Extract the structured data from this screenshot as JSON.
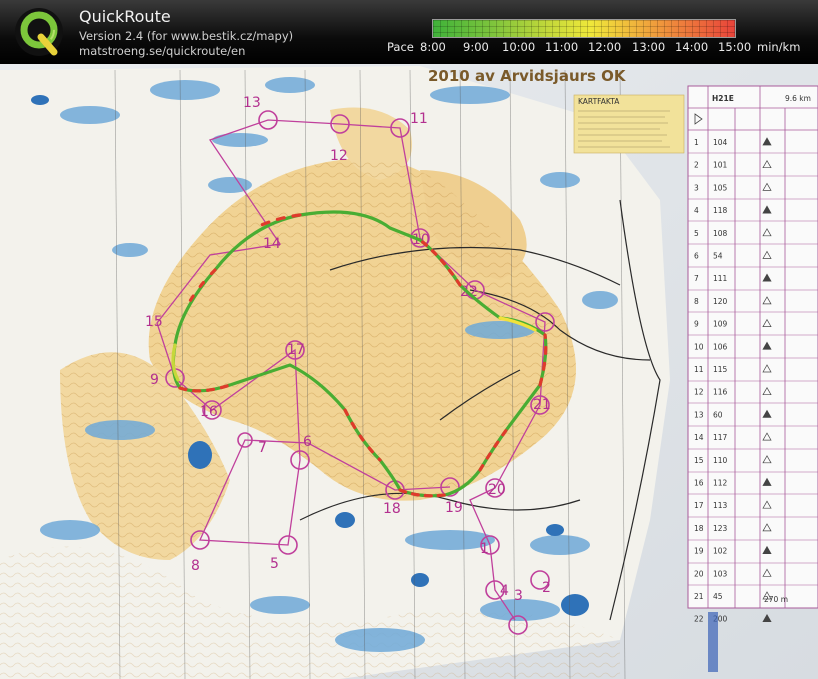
{
  "header": {
    "app_name": "QuickRoute",
    "version_line": "Version 2.4  (for www.bestik.cz/mapy)",
    "url": "matstroeng.se/quickroute/en"
  },
  "pace_scale": {
    "label": "Pace",
    "ticks": [
      "8:00",
      "9:00",
      "10:00",
      "11:00",
      "12:00",
      "13:00",
      "14:00",
      "15:00"
    ],
    "unit": "min/km",
    "colors": [
      "#3fb23a",
      "#7fc53c",
      "#c3d83a",
      "#efe83a",
      "#f0b83c",
      "#ee7f3c",
      "#e8433a"
    ]
  },
  "map": {
    "header_text": "2010 av Arvidsjaurs OK",
    "kartfakta_title": "KARTFAKTA",
    "control_labels": [
      "1",
      "2",
      "3",
      "4",
      "5",
      "6",
      "7",
      "8",
      "9",
      "10",
      "11",
      "12",
      "13",
      "14",
      "15",
      "16",
      "17",
      "18",
      "19",
      "20",
      "21",
      "22"
    ],
    "description_sheet": {
      "class": "H21E",
      "distance": "9.6 km",
      "footer_distance": "270 m",
      "rows": [
        {
          "num": "1",
          "code": "104"
        },
        {
          "num": "2",
          "code": "101"
        },
        {
          "num": "3",
          "code": "105"
        },
        {
          "num": "4",
          "code": "118"
        },
        {
          "num": "5",
          "code": "108"
        },
        {
          "num": "6",
          "code": "54"
        },
        {
          "num": "7",
          "code": "111"
        },
        {
          "num": "8",
          "code": "120"
        },
        {
          "num": "9",
          "code": "109"
        },
        {
          "num": "10",
          "code": "106"
        },
        {
          "num": "11",
          "code": "115"
        },
        {
          "num": "12",
          "code": "116"
        },
        {
          "num": "13",
          "code": "60"
        },
        {
          "num": "14",
          "code": "117"
        },
        {
          "num": "15",
          "code": "110"
        },
        {
          "num": "16",
          "code": "112"
        },
        {
          "num": "17",
          "code": "113"
        },
        {
          "num": "18",
          "code": "123"
        },
        {
          "num": "19",
          "code": "102"
        },
        {
          "num": "20",
          "code": "103"
        },
        {
          "num": "21",
          "code": "45"
        },
        {
          "num": "22",
          "code": "200"
        }
      ]
    }
  }
}
